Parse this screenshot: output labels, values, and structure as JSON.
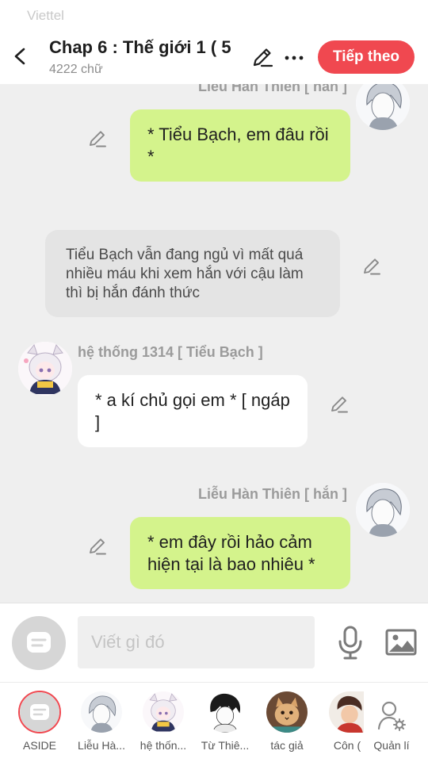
{
  "status_bar": {
    "carrier": "Viettel"
  },
  "header": {
    "title": "Chap 6 : Thế giới 1 ( 5",
    "word_count": "4222 chữ",
    "next_button": "Tiếp theo"
  },
  "messages": [
    {
      "kind": "right",
      "speaker": "Liễu Hàn Thiên [ hắn ]",
      "text": "* Tiểu Bạch, em đâu rồi *",
      "avatar_icon": "gray-haired-man-avatar"
    },
    {
      "kind": "narration",
      "text": "Tiểu Bạch vẫn đang ngủ vì mất quá nhiều máu khi xem hắn với cậu làm thì bị hắn đánh thức"
    },
    {
      "kind": "left",
      "speaker": "hệ thống 1314 [ Tiểu Bạch ]",
      "text": "* a kí chủ gọi em * [ ngáp ]",
      "avatar_icon": "white-haired-girl-avatar"
    },
    {
      "kind": "right",
      "speaker": "Liễu Hàn Thiên [ hắn ]",
      "text": "* em đây rồi hảo cảm hiện tại là bao nhiêu *",
      "avatar_icon": "gray-haired-man-avatar"
    }
  ],
  "input": {
    "placeholder": "Viết gì đó"
  },
  "tabs": [
    {
      "label": "ASIDE",
      "icon": "aside-chat-icon",
      "selected": true
    },
    {
      "label": "Liễu Hà...",
      "icon": "gray-haired-man-avatar"
    },
    {
      "label": "hệ thốn...",
      "icon": "white-haired-girl-avatar"
    },
    {
      "label": "Từ Thiê...",
      "icon": "black-haired-boy-avatar"
    },
    {
      "label": "tác giả",
      "icon": "cat-avatar"
    },
    {
      "label": "Côn (",
      "icon": "red-shirt-boy-avatar"
    },
    {
      "label": "Quản lí",
      "icon": "user-gear-icon"
    }
  ],
  "colors": {
    "accent": "#f04850",
    "my_bubble": "#d4f38c",
    "other_bubble": "#ffffff",
    "narration_bubble": "#e4e4e4",
    "background": "#efefef"
  }
}
